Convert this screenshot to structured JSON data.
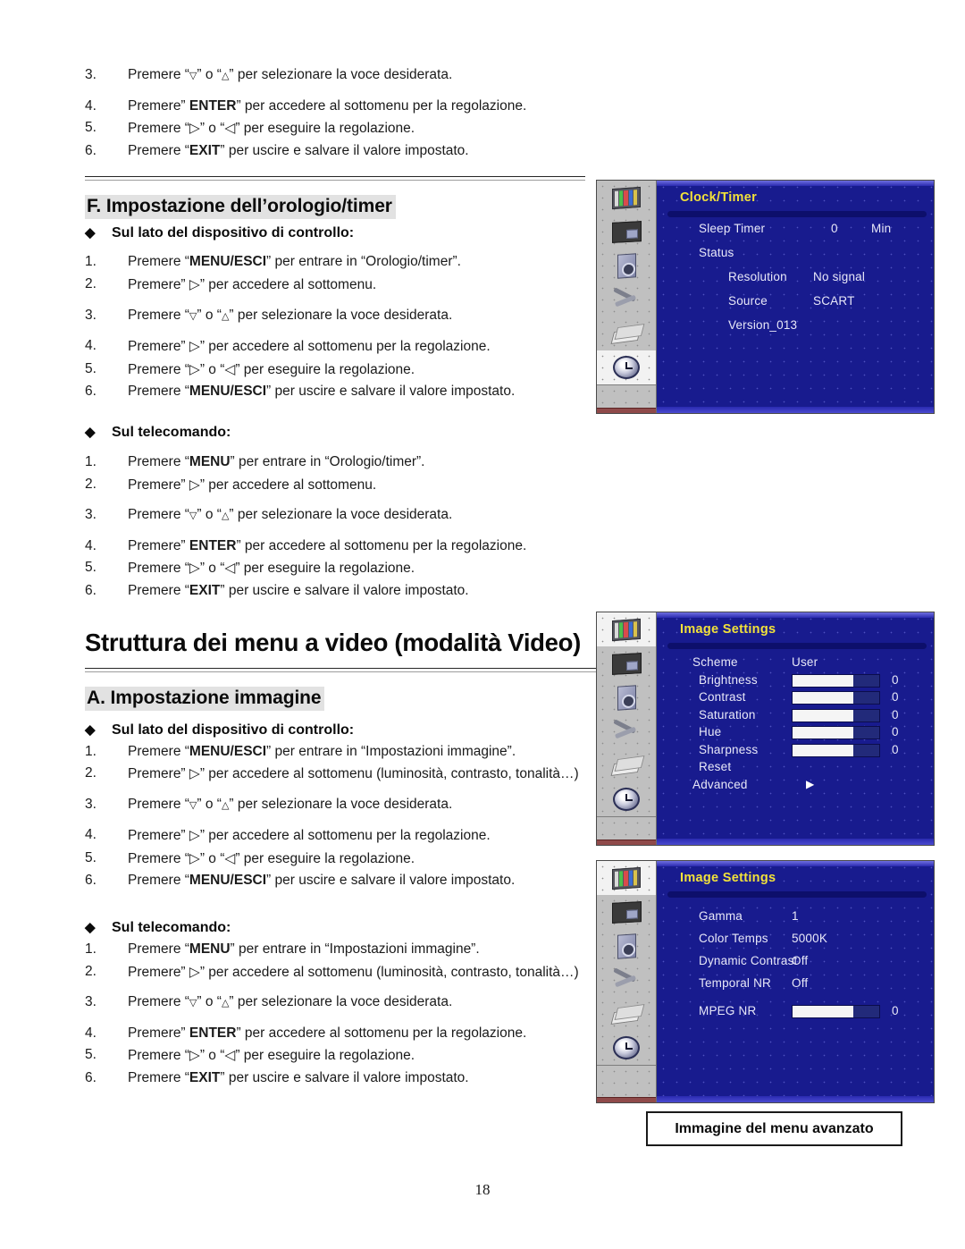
{
  "page": {
    "number": "18"
  },
  "top_steps": [
    {
      "num": "3.",
      "html": "Premere “▽” o “△” per selezionare la voce desiderata."
    },
    {
      "num": "4.",
      "html": "Premere” ENTER” per accedere al sottomenu per la regolazione."
    },
    {
      "num": "5.",
      "html": "Premere “▷” o “◁” per eseguire la regolazione."
    },
    {
      "num": "6.",
      "html": "Premere “EXIT” per uscire e salvare il valore impostato."
    }
  ],
  "section_f": {
    "heading": "F. Impostazione dell’orologio/timer",
    "bullet_device": "Sul lato del dispositivo di controllo:",
    "bullet_remote": "Sul telecomando:",
    "device_steps": [
      {
        "num": "1.",
        "html": "Premere “MENU/ESCI” per entrare in “Orologio/timer”."
      },
      {
        "num": "2.",
        "html": "Premere” ▷” per accedere al sottomenu."
      },
      {
        "num": "3.",
        "html": "Premere “▽” o “△” per selezionare la voce desiderata."
      },
      {
        "num": "4.",
        "html": "Premere” ▷” per accedere al sottomenu per la regolazione."
      },
      {
        "num": "5.",
        "html": "Premere “▷” o “◁” per eseguire la regolazione."
      },
      {
        "num": "6.",
        "html": "Premere “MENU/ESCI” per uscire e salvare il valore impostato."
      }
    ],
    "remote_steps": [
      {
        "num": "1.",
        "html": "Premere “MENU” per entrare in “Orologio/timer”."
      },
      {
        "num": "2.",
        "html": "Premere” ▷” per accedere al sottomenu."
      },
      {
        "num": "3.",
        "html": "Premere “▽” o “△” per selezionare la voce desiderata."
      },
      {
        "num": "4.",
        "html": "Premere” ENTER” per accedere al sottomenu per la regolazione."
      },
      {
        "num": "5.",
        "html": "Premere “▷” o “◁” per eseguire la regolazione."
      },
      {
        "num": "6.",
        "html": "Premere “EXIT” per uscire e salvare il valore impostato."
      }
    ]
  },
  "chapter_title": "Struttura dei menu a video (modalità Video)",
  "section_a": {
    "heading": "A. Impostazione immagine",
    "bullet_device": "Sul lato del dispositivo di controllo:",
    "bullet_remote": "Sul telecomando:",
    "device_steps": [
      {
        "num": "1.",
        "html": "Premere “MENU/ESCI” per entrare in “Impostazioni immagine”."
      },
      {
        "num": "2.",
        "html": "Premere” ▷” per accedere al sottomenu (luminosità, contrasto, tonalità…)"
      },
      {
        "num": "3.",
        "html": "Premere “▽” o “△” per selezionare la voce desiderata."
      },
      {
        "num": "4.",
        "html": "Premere” ▷” per accedere al sottomenu per la regolazione."
      },
      {
        "num": "5.",
        "html": "Premere “▷” o “◁” per eseguire la regolazione."
      },
      {
        "num": "6.",
        "html": "Premere “MENU/ESCI” per uscire e salvare il valore impostato."
      }
    ],
    "remote_steps": [
      {
        "num": "1.",
        "html": "Premere “MENU” per entrare in “Impostazioni immagine”."
      },
      {
        "num": "2.",
        "html": "Premere” ▷” per accedere al sottomenu (luminosità, contrasto, tonalità…)"
      },
      {
        "num": "3.",
        "html": "Premere “▽” o “△” per selezionare la voce desiderata."
      },
      {
        "num": "4.",
        "html": "Premere” ENTER” per accedere al sottomenu per la regolazione."
      },
      {
        "num": "5.",
        "html": "Premere “▷” o “◁” per eseguire la regolazione."
      },
      {
        "num": "6.",
        "html": "Premere “EXIT” per uscire e salvare il valore impostato."
      }
    ]
  },
  "osd_rail_icons": [
    {
      "name": "image-settings-icon",
      "active": true
    },
    {
      "name": "screen-settings-icon",
      "active": false
    },
    {
      "name": "audio-settings-icon",
      "active": false
    },
    {
      "name": "setup-tools-icon",
      "active": false
    },
    {
      "name": "osd-settings-icon",
      "active": false
    },
    {
      "name": "clock-timer-icon",
      "active": false
    }
  ],
  "osd_clock": {
    "title": "Clock/Timer",
    "active_icon_index": 5,
    "rows": [
      {
        "label": "Sleep Timer",
        "value": "0",
        "unit": "Min",
        "indent": 0
      },
      {
        "label": "Status",
        "value": "",
        "unit": "",
        "indent": 0
      },
      {
        "label": "Resolution",
        "value": "No signal",
        "unit": "",
        "indent": 1
      },
      {
        "label": "Source",
        "value": "SCART",
        "unit": "",
        "indent": 1
      },
      {
        "label": "Version_013",
        "value": "",
        "unit": "",
        "indent": 1
      }
    ]
  },
  "osd_image": {
    "title": "Image Settings",
    "active_icon_index": 0,
    "rows": [
      {
        "label": "Scheme",
        "value": "User",
        "indent": 0,
        "type": "value"
      },
      {
        "label": "Brightness",
        "value": "0",
        "indent": 1,
        "type": "slider",
        "fill": 70
      },
      {
        "label": "Contrast",
        "value": "0",
        "indent": 1,
        "type": "slider",
        "fill": 70
      },
      {
        "label": "Saturation",
        "value": "0",
        "indent": 1,
        "type": "slider",
        "fill": 70
      },
      {
        "label": "Hue",
        "value": "0",
        "indent": 1,
        "type": "slider",
        "fill": 70
      },
      {
        "label": "Sharpness",
        "value": "0",
        "indent": 1,
        "type": "slider",
        "fill": 70
      },
      {
        "label": "Reset",
        "value": "",
        "indent": 1,
        "type": "value"
      },
      {
        "label": "Advanced",
        "value": "▶",
        "indent": 0,
        "type": "submenu"
      }
    ]
  },
  "osd_image_advanced": {
    "title": "Image Settings",
    "active_icon_index": 0,
    "rows": [
      {
        "label": "Gamma",
        "value": "1",
        "indent": 1,
        "type": "value"
      },
      {
        "label": "Color Temps",
        "value": "5000K",
        "indent": 1,
        "type": "value"
      },
      {
        "label": "Dynamic Contrast",
        "value": "Off",
        "indent": 1,
        "type": "value"
      },
      {
        "label": "Temporal NR",
        "value": "Off",
        "indent": 1,
        "type": "value"
      },
      {
        "label": "MPEG NR",
        "value": "0",
        "indent": 1,
        "type": "slider",
        "fill": 70
      }
    ]
  },
  "caption": "Immagine del menu avanzato",
  "colors": {
    "osd_blue": "#181b8e",
    "osd_title_yellow": "#f2e23a",
    "heading_highlight": "#e2e2e2"
  }
}
